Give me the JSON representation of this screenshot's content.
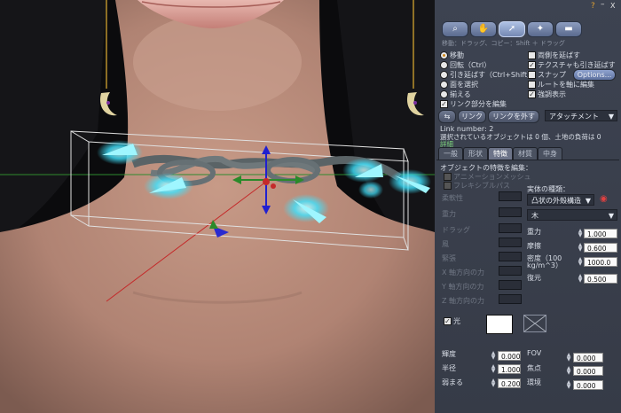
{
  "toolbar": {
    "icons": [
      "magnifier-icon",
      "hand-icon",
      "cursor-icon",
      "wand-icon",
      "bulldozer-icon"
    ],
    "help": "?",
    "minimize": "–",
    "close": "X",
    "hint": "移動：ドラッグ、コピー：Shift ＋ ドラッグ"
  },
  "edit_modes": {
    "move": "移動",
    "rotate": "回転（Ctrl）",
    "stretch": "引き延ばす（Ctrl+Shift）",
    "select_face": "面を選択",
    "align": "揃える",
    "edit_linked": "リンク部分を編集"
  },
  "options": {
    "stretch_both": "両側を延ばす",
    "stretch_textures": "テクスチャも引き延ばす",
    "snap": "スナップ",
    "options_button": "Options...",
    "ruler_root": "ルートを軸に編集",
    "highlight": "強調表示"
  },
  "link": {
    "link_button": "リンク",
    "unlink_button": "リンクを外す",
    "attachment": "アタッチメント"
  },
  "info": {
    "link_number": "Link number: 2",
    "selection": "選択されているオブジェクトは 0 個、土地の負荷は 0",
    "more_info": "詳細"
  },
  "tabs": [
    "一般",
    "形状",
    "特徴",
    "材質",
    "中身"
  ],
  "features": {
    "heading": "オブジェクトの特徴を編集：",
    "animated_mesh": "アニメーションメッシュ",
    "flexible_path": "フレキシブルパス",
    "physics_type_label": "実体の種類：",
    "physics_type_value": "凸状の外殻構造",
    "material_value": "木",
    "flex_labels": [
      "柔軟性",
      "重力",
      "ドラッグ",
      "風",
      "緊張",
      "X 軸方向の力",
      "Y 軸方向の力",
      "Z 軸方向の力"
    ],
    "phys_labels": [
      "重力",
      "摩擦",
      "密度（100 kg/m^3）",
      "復元"
    ],
    "phys_values": [
      "1.000",
      "0.600",
      "1000.0",
      "0.500"
    ],
    "light_label": "光",
    "light_fields": [
      "輝度",
      "半径",
      "弱まる"
    ],
    "light_values": [
      "0.000",
      "1.000",
      "0.200"
    ],
    "proj_fields": [
      "FOV",
      "焦点",
      "環境"
    ],
    "proj_values": [
      "0.000",
      "0.000",
      "0.000"
    ]
  },
  "colors": {
    "panel_bg": "#3a3f4b",
    "glow": "#3fe3ff",
    "accent": "#d08a1c"
  }
}
